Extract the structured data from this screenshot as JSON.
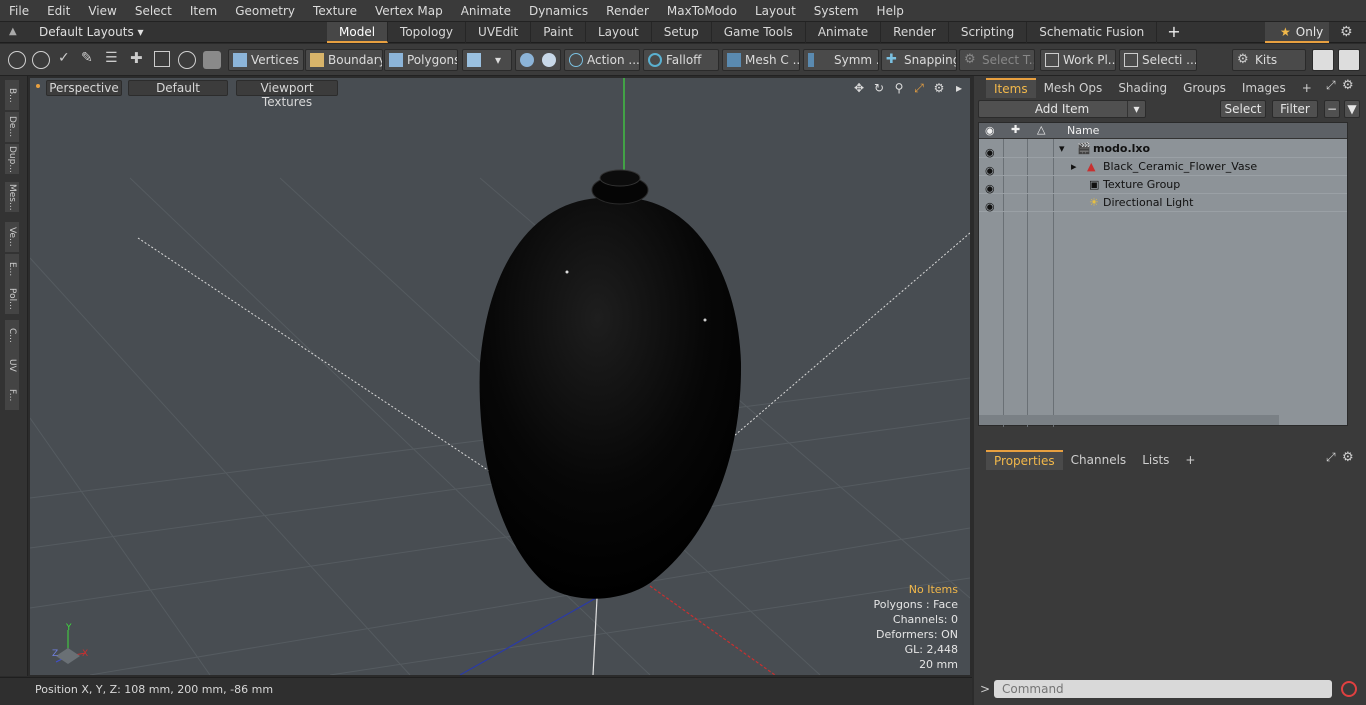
{
  "menu": [
    "File",
    "Edit",
    "View",
    "Select",
    "Item",
    "Geometry",
    "Texture",
    "Vertex Map",
    "Animate",
    "Dynamics",
    "Render",
    "MaxToModo",
    "Layout",
    "System",
    "Help"
  ],
  "layout": {
    "title": "Default Layouts ▾"
  },
  "tabs": [
    "Model",
    "Topology",
    "UVEdit",
    "Paint",
    "Layout",
    "Setup",
    "Game Tools",
    "Animate",
    "Render",
    "Scripting",
    "Schematic Fusion"
  ],
  "only_label": "Only",
  "toolbar": {
    "vertices": "Vertices",
    "boundary": "Boundary",
    "polygons": "Polygons",
    "action": "Action",
    "action_more": "...",
    "falloff": "Falloff",
    "meshc": "Mesh C ...",
    "symm": "Symm ...",
    "snapping": "Snapping",
    "selectt": "Select T...",
    "workpl": "Work Pl...",
    "selecti": "Selecti ...",
    "kits": "Kits"
  },
  "left_tabs": [
    "B...",
    "De...",
    "Dup...",
    "Mes...",
    "Ve...",
    "E...",
    "Pol...",
    "C...",
    "UV",
    "F..."
  ],
  "viewport": {
    "perspective": "Perspective",
    "default": "Default",
    "textures": "Viewport Textures",
    "stats": {
      "no_items": "No Items",
      "polygons": "Polygons : Face",
      "channels": "Channels: 0",
      "deformers": "Deformers: ON",
      "gl": "GL: 2,448",
      "scale": "20 mm"
    }
  },
  "status": {
    "position": "Position X, Y, Z:   108 mm, 200 mm, -86 mm"
  },
  "right_panel": {
    "tabs": [
      "Items",
      "Mesh Ops",
      "Shading",
      "Groups",
      "Images"
    ],
    "add_item": "Add Item",
    "select": "Select",
    "filter": "Filter",
    "col_name": "Name",
    "items": [
      {
        "name": "modo.lxo",
        "bold": true
      },
      {
        "name": "Black_Ceramic_Flower_Vase"
      },
      {
        "name": "Texture Group"
      },
      {
        "name": "Directional Light"
      }
    ],
    "props_tabs": [
      "Properties",
      "Channels",
      "Lists"
    ],
    "command_placeholder": "Command"
  },
  "colors": {
    "accent": "#e8a040",
    "viewport": "#484d52"
  }
}
